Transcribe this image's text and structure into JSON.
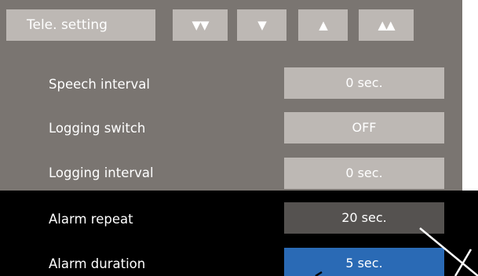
{
  "header": {
    "title": "Tele. setting",
    "nav": {
      "fast_down": "▼▼",
      "down": "▼",
      "up": "▲",
      "fast_up": "▲▲"
    }
  },
  "settings": [
    {
      "label": "Speech interval",
      "value": "0 sec."
    },
    {
      "label": "Logging switch",
      "value": "OFF"
    },
    {
      "label": "Logging interval",
      "value": "0 sec."
    },
    {
      "label": "Alarm repeat",
      "value": "20 sec."
    },
    {
      "label": "Alarm duration",
      "value": "5 sec."
    }
  ],
  "colors": {
    "panel": "#7a7571",
    "button": "#bdb8b4",
    "dark_band": "#000000",
    "dark_value": "#555250",
    "selected_value": "#2a6ab5",
    "text": "#ffffff"
  }
}
